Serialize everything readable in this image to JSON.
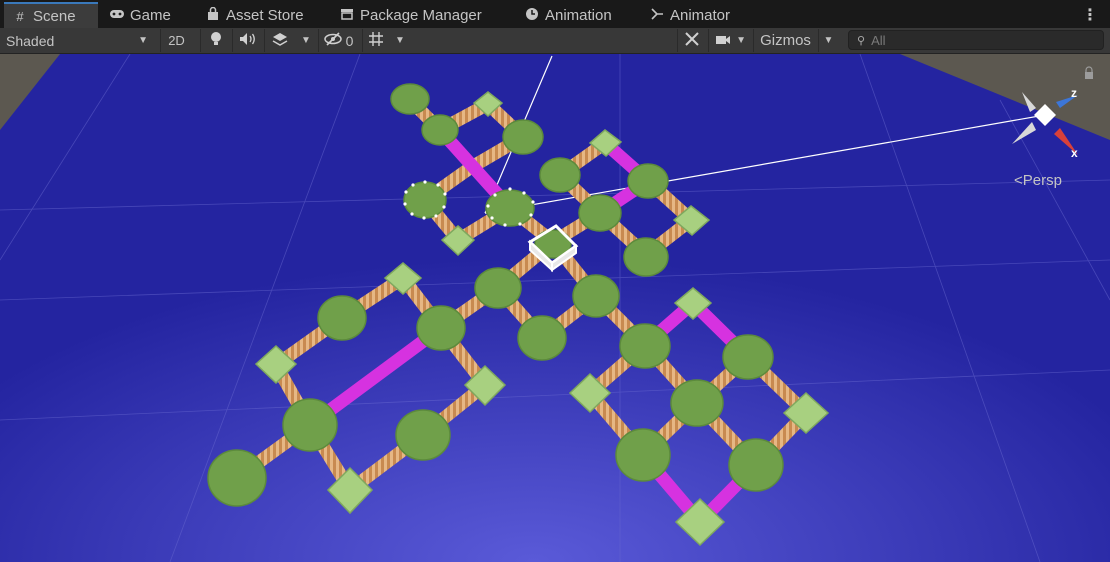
{
  "tabs": [
    {
      "label": "Scene",
      "icon": "grid-icon",
      "active": true
    },
    {
      "label": "Game",
      "icon": "gamepad-icon",
      "active": false
    },
    {
      "label": "Asset Store",
      "icon": "shopping-bag-icon",
      "active": false
    },
    {
      "label": "Package Manager",
      "icon": "package-icon",
      "active": false
    },
    {
      "label": "Animation",
      "icon": "clock-icon",
      "active": false
    },
    {
      "label": "Animator",
      "icon": "animator-icon",
      "active": false
    }
  ],
  "toolbar": {
    "draw_mode": "Shaded",
    "mode_2d": "2D",
    "hidden_count": "0",
    "gizmos_label": "Gizmos",
    "search_placeholder": "All"
  },
  "scene_gizmo": {
    "z_label": "z",
    "x_label": "x",
    "projection_label": "Persp"
  },
  "colors": {
    "ground": "#2424a0",
    "node": "#70a04a",
    "bridge": "#d890c0",
    "pink_path": "#d632e0",
    "square_tile": "#a8d080"
  }
}
